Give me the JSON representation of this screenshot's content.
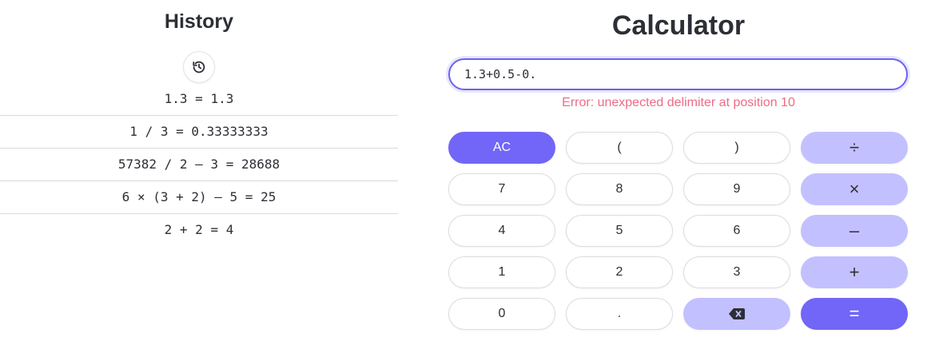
{
  "history": {
    "title": "History",
    "entries": [
      "1.3 = 1.3",
      "1 / 3 = 0.33333333",
      "57382 / 2 – 3 = 28688",
      "6 × (3 + 2) – 5 = 25",
      "2 + 2 = 4"
    ]
  },
  "calculator": {
    "title": "Calculator",
    "input_value": "1.3+0.5-0.",
    "error": "Error: unexpected delimiter at position 10",
    "keys": {
      "clear": "AC",
      "paren_open": "(",
      "paren_close": ")",
      "divide": "÷",
      "seven": "7",
      "eight": "8",
      "nine": "9",
      "multiply": "×",
      "four": "4",
      "five": "5",
      "six": "6",
      "minus": "–",
      "one": "1",
      "two": "2",
      "three": "3",
      "plus": "+",
      "zero": "0",
      "dot": ".",
      "equals": "="
    }
  },
  "icons": {
    "history": "history-icon",
    "backspace": "backspace-icon"
  },
  "colors": {
    "accent": "#7166f7",
    "operator": "#c3c0ff",
    "error": "#ee6b85",
    "text": "#2d2f36"
  }
}
